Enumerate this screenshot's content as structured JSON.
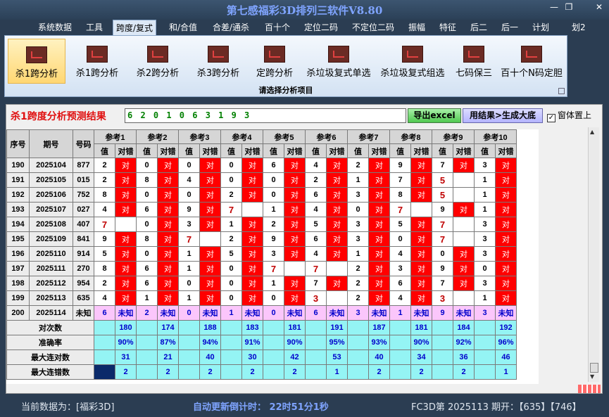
{
  "window": {
    "title": "第七感福彩3D排列三软件V8.80",
    "minimize_glyph": "—",
    "maximize_glyph": "❐",
    "close_glyph": "✕"
  },
  "menu": [
    "系统数据",
    "工具",
    "跨度/复式",
    "和/合值",
    "合差/通杀",
    "百十个",
    "定位二码",
    "不定位二码",
    "振幅",
    "特征",
    "后二",
    "后一",
    "计划",
    "划2"
  ],
  "ribbon": {
    "buttons": [
      "杀1跨分析",
      "杀1跨分析",
      "杀2跨分析",
      "杀3跨分析",
      "定跨分析",
      "杀垃圾复式单选",
      "杀垃圾复式组选",
      "七码保三",
      "百十个N码定胆"
    ],
    "group_label": "请选择分析项目"
  },
  "analysis": {
    "result_label": "杀1跨度分析预测结果",
    "result_value": "6 2 0 1 0 6 3 1 9 3",
    "export_button": "导出excel",
    "generate_button": "用结果>生成大底",
    "ontop_label": "窗体置上",
    "ontop_check": "✓"
  },
  "table": {
    "headers": {
      "seq": "序号",
      "period": "期号",
      "number": "号码",
      "value": "值",
      "check": "对错"
    },
    "refs": [
      "参考1",
      "参考2",
      "参考3",
      "参考4",
      "参考5",
      "参考6",
      "参考7",
      "参考8",
      "参考9",
      "参考10"
    ],
    "rows": [
      {
        "seq": "190",
        "period": "2025104",
        "num": "877",
        "c": [
          [
            "2",
            "对"
          ],
          [
            "0",
            "对"
          ],
          [
            "0",
            "对"
          ],
          [
            "0",
            "对"
          ],
          [
            "6",
            "对"
          ],
          [
            "4",
            "对"
          ],
          [
            "2",
            "对"
          ],
          [
            "9",
            "对"
          ],
          [
            "7",
            "对"
          ],
          [
            "3",
            "对"
          ]
        ]
      },
      {
        "seq": "191",
        "period": "2025105",
        "num": "015",
        "c": [
          [
            "2",
            "对"
          ],
          [
            "8",
            "对"
          ],
          [
            "4",
            "对"
          ],
          [
            "0",
            "对"
          ],
          [
            "0",
            "对"
          ],
          [
            "2",
            "对"
          ],
          [
            "1",
            "对"
          ],
          [
            "7",
            "对"
          ],
          [
            "5",
            ""
          ],
          [
            "1",
            "对"
          ]
        ]
      },
      {
        "seq": "192",
        "period": "2025106",
        "num": "752",
        "c": [
          [
            "8",
            "对"
          ],
          [
            "0",
            "对"
          ],
          [
            "0",
            "对"
          ],
          [
            "2",
            "对"
          ],
          [
            "0",
            "对"
          ],
          [
            "6",
            "对"
          ],
          [
            "3",
            "对"
          ],
          [
            "8",
            "对"
          ],
          [
            "5",
            ""
          ],
          [
            "1",
            "对"
          ]
        ]
      },
      {
        "seq": "193",
        "period": "2025107",
        "num": "027",
        "c": [
          [
            "4",
            "对"
          ],
          [
            "6",
            "对"
          ],
          [
            "9",
            "对"
          ],
          [
            "7",
            ""
          ],
          [
            "1",
            "对"
          ],
          [
            "4",
            "对"
          ],
          [
            "0",
            "对"
          ],
          [
            "7",
            ""
          ],
          [
            "9",
            "对"
          ],
          [
            "1",
            "对"
          ]
        ]
      },
      {
        "seq": "194",
        "period": "2025108",
        "num": "407",
        "c": [
          [
            "7",
            ""
          ],
          [
            "0",
            "对"
          ],
          [
            "3",
            "对"
          ],
          [
            "1",
            "对"
          ],
          [
            "2",
            "对"
          ],
          [
            "5",
            "对"
          ],
          [
            "3",
            "对"
          ],
          [
            "5",
            "对"
          ],
          [
            "7",
            ""
          ],
          [
            "3",
            "对"
          ]
        ]
      },
      {
        "seq": "195",
        "period": "2025109",
        "num": "841",
        "c": [
          [
            "9",
            "对"
          ],
          [
            "8",
            "对"
          ],
          [
            "7",
            ""
          ],
          [
            "2",
            "对"
          ],
          [
            "9",
            "对"
          ],
          [
            "6",
            "对"
          ],
          [
            "3",
            "对"
          ],
          [
            "0",
            "对"
          ],
          [
            "7",
            ""
          ],
          [
            "3",
            "对"
          ]
        ]
      },
      {
        "seq": "196",
        "period": "2025110",
        "num": "914",
        "c": [
          [
            "5",
            "对"
          ],
          [
            "0",
            "对"
          ],
          [
            "1",
            "对"
          ],
          [
            "5",
            "对"
          ],
          [
            "3",
            "对"
          ],
          [
            "4",
            "对"
          ],
          [
            "1",
            "对"
          ],
          [
            "4",
            "对"
          ],
          [
            "0",
            "对"
          ],
          [
            "3",
            "对"
          ]
        ]
      },
      {
        "seq": "197",
        "period": "2025111",
        "num": "270",
        "c": [
          [
            "8",
            "对"
          ],
          [
            "6",
            "对"
          ],
          [
            "1",
            "对"
          ],
          [
            "0",
            "对"
          ],
          [
            "7",
            ""
          ],
          [
            "7",
            ""
          ],
          [
            "2",
            "对"
          ],
          [
            "3",
            "对"
          ],
          [
            "9",
            "对"
          ],
          [
            "0",
            "对"
          ]
        ]
      },
      {
        "seq": "198",
        "period": "2025112",
        "num": "954",
        "c": [
          [
            "2",
            "对"
          ],
          [
            "6",
            "对"
          ],
          [
            "0",
            "对"
          ],
          [
            "0",
            "对"
          ],
          [
            "1",
            "对"
          ],
          [
            "7",
            "对"
          ],
          [
            "2",
            "对"
          ],
          [
            "6",
            "对"
          ],
          [
            "7",
            "对"
          ],
          [
            "3",
            "对"
          ]
        ]
      },
      {
        "seq": "199",
        "period": "2025113",
        "num": "635",
        "c": [
          [
            "4",
            "对"
          ],
          [
            "1",
            "对"
          ],
          [
            "1",
            "对"
          ],
          [
            "0",
            "对"
          ],
          [
            "0",
            "对"
          ],
          [
            "3",
            ""
          ],
          [
            "2",
            "对"
          ],
          [
            "4",
            "对"
          ],
          [
            "3",
            ""
          ],
          [
            "1",
            "对"
          ]
        ]
      }
    ],
    "pending": {
      "seq": "200",
      "period": "2025114",
      "num": "未知",
      "c": [
        [
          "6",
          "未知"
        ],
        [
          "2",
          "未知"
        ],
        [
          "0",
          "未知"
        ],
        [
          "1",
          "未知"
        ],
        [
          "0",
          "未知"
        ],
        [
          "6",
          "未知"
        ],
        [
          "3",
          "未知"
        ],
        [
          "1",
          "未知"
        ],
        [
          "9",
          "未知"
        ],
        [
          "3",
          "未知"
        ]
      ]
    },
    "stats": [
      {
        "label": "对次数",
        "values": [
          "180",
          "174",
          "188",
          "183",
          "181",
          "191",
          "187",
          "181",
          "184",
          "192"
        ]
      },
      {
        "label": "准确率",
        "values": [
          "90%",
          "87%",
          "94%",
          "91%",
          "90%",
          "95%",
          "93%",
          "90%",
          "92%",
          "96%"
        ]
      },
      {
        "label": "最大连对数",
        "values": [
          "31",
          "21",
          "40",
          "30",
          "42",
          "53",
          "40",
          "34",
          "36",
          "46"
        ]
      },
      {
        "label": "最大连错数",
        "values": [
          "2",
          "2",
          "2",
          "2",
          "2",
          "1",
          "2",
          "2",
          "2",
          "1"
        ]
      }
    ]
  },
  "status": {
    "current": "当前数据为：[福彩3D]",
    "countdown": "自动更新倒计时：  22时51分1秒",
    "draw": "FC3D第 2025113 期开：【635】【746】"
  },
  "colors": {
    "hit": "#ff0000",
    "miss_value": "#c00000",
    "stats_bg": "#94f4f4",
    "pending_bg": "#fbc6fb",
    "title": "#7fa4ff"
  }
}
